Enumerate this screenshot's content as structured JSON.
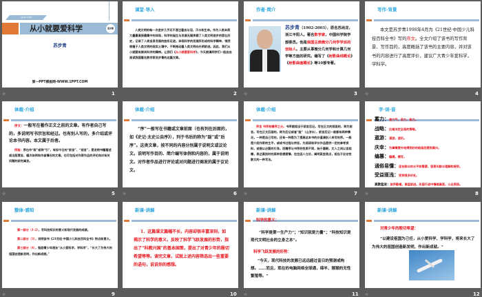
{
  "slides": [
    {
      "num": "1",
      "banner_small": "语文版·七年级",
      "title": "从小就要爱科学",
      "badge": "语文版",
      "author": "苏步青",
      "footer": "第一PPT模板网-WWW.1PPT.COM"
    },
    {
      "num": "2",
      "heading": "课堂·导入",
      "text_a": "人类文明的每一次进步几乎无不浸注着血与泪、汗水和生命。作为人类本质力量最直接最集中的体现，科学的诞生与发展无疑承载了人类文明进步的悲壮历史，记录了人类自身发展的曲折足迹。体现科学的发展所形成的科学精神，悄然根植于人类文明的现实土壤中，不断推动着人类文明向光明前进。因此，我们从小就要有崇尚科学的精神。让我们《",
      "text_red": "从小就要爱科学",
      "text_b": "》，今天就请同学们一起自由阅读我国著名数学家苏步青的这篇文章。"
    },
    {
      "num": "3",
      "heading": "作者·简介",
      "name": "苏步青",
      "p1": "（1902-2003），原名苏尚龙，浙江平阳人。著名",
      "r1": "数学家",
      "p2": "，中国科学院学部委员。他是",
      "r2": "我国古典微分几何学学派的创始人",
      "p3": "。主要从事微分几何学和计算几何学等方面的研究。编写了《",
      "r3": "射影曲线概论",
      "p4": "》《",
      "r4": "射影曲面概论",
      "p5": "》等10部专著。"
    },
    {
      "num": "4",
      "heading": "写作·背景",
      "p1": "本文是苏步青1998年4月为《21世纪·中国少儿科技百科全书》写的",
      "r1": "序文",
      "p2": "。全文介绍了该书的写作背景、写作目的，高度概括了该书的主要内容，并对该书的内容进行了高度评价，建议广大青少年爱科学，学科学。"
    },
    {
      "num": "5",
      "heading": "体裁·介绍",
      "r1": "序文：",
      "p1": "一般写在著作正文之前的文章。有作者自己写的，多说明写书宗旨和经过。也有别人写的，多介绍或评论本书内容。本文属于后者。",
      "r2": "序跋：",
      "p2": "序也作“叙”或称“引”，有如今日的“前言”、“前言”，是说明书籍著述或出版意旨、编次体例和作者情况的文章。也可包括对作家作品的评论和对有关问题的研究阐发。"
    },
    {
      "num": "6",
      "heading": "体裁·介绍",
      "p1": "“序”一般写在书籍或文章前面（也有列在后面的，如《史记·太史公自序》），列于书后的称为“跋”或“后序”。这类文章，按不同的内容分别属于说明文或议论文。说明写作目的、简介编写体例和内容的，属于说明文。对作者作品进行评论或对问题进行阐发的属于议论文。"
    },
    {
      "num": "7",
      "heading": "体裁·介绍",
      "r1": "序言 书序和赠序之分。",
      "p1": "书序就相当于前言后记。写在正文的前面的，称为前言。写在正文后面的，称为后记或者“跋”（山涉水），前言后记一般都有两种情况，一种是自己写的，还有一种是为了提高这本书的价值请别人来写的序。一般是介绍作家的生平，或成书过程与宗旨，为阅读和评价作品提供一定的参考资料，或做以必要的引导。而赠序与书序的性质不同，始于唐朝，文人之间以言相赠，表达离别时的某种思想感情，往往因人立论，阐明某些观点，相当于议论性散文的一种写法。"
    },
    {
      "num": "8",
      "heading": "字·词·音",
      "items": [
        {
          "w": "蓄力：",
          "d": "使力气，用力，致力。"
        },
        {
          "w": "战略：",
          "d": "比喻决定全局的策略。"
        },
        {
          "w": "遨游：",
          "d": "漫游，游历。"
        },
        {
          "w": "庆幸：",
          "d": "为事情意外地得到好的结局而感到高兴。"
        },
        {
          "w": "编篡：",
          "d": "编辑，撰写。"
        },
        {
          "w": "通俗易懂：",
          "d": "适合群众的水平和需要，容易叫群众理解和接受。"
        },
        {
          "w": "受益匪浅：",
          "d": "受到很多好处。"
        },
        {
          "w": "高歌猛进：",
          "d": "放声歌唱，勇猛前进。形容行进中情绪高涨，斗志昂扬。"
        }
      ]
    },
    {
      "num": "9",
      "heading": "整体·感知",
      "parts": [
        {
          "r": "第一部分（1-2）",
          "p": "，写科技知识的意义和现代发展的成就。"
        },
        {
          "r": "第二部分（3）",
          "p": "，说明该书《21世纪·中国少儿科技百科全书》特点和意义。"
        },
        {
          "r": "第三部分（4）",
          "p": "，勉励青少年朋友“从小爱科学，学科学”，“长大了为伟大的祖国创造新发明，作出新成就。”"
        }
      ]
    },
    {
      "num": "10",
      "heading": "新课·讲解",
      "p1": "1．这篇课文篇幅不长，内容却很丰富深刻，如揭示了科学的意义，反映了科学飞跃发展的形势，指出了“科教兴国”的基本国策，提出了对青少年的殷切希望等等。读完文章，试就上述内容筛选出一些重要的语句，说说你的感想。"
    },
    {
      "num": "11",
      "heading": "新课·讲解",
      "r1": "科学的意义：",
      "p1": "“科学是第一生产力”；“知识就是力量”；“科技知识是现代文明社会的立身之本”。",
      "r2": "科学飞跃发展的形势：",
      "p2": "“今天，现代科技的发展已远远超过昔日的预测或构想。……而且，现在的电脑网络全球通，绵羊、猴猴的无性繁殖等。”"
    },
    {
      "num": "12",
      "heading": "新课·讲解",
      "r1": "对青少年的殷切希望：",
      "p1": "“以建设祖国为己任，从小爱科学、学科学，将来长大了为伟大的祖国创造新发明，作出新成就。”"
    }
  ],
  "colors": {
    "accent_blue": "#2aa6e0",
    "accent_red": "#e8141c",
    "orange": "#e07a36",
    "bar_blue": "#9bbad6"
  }
}
